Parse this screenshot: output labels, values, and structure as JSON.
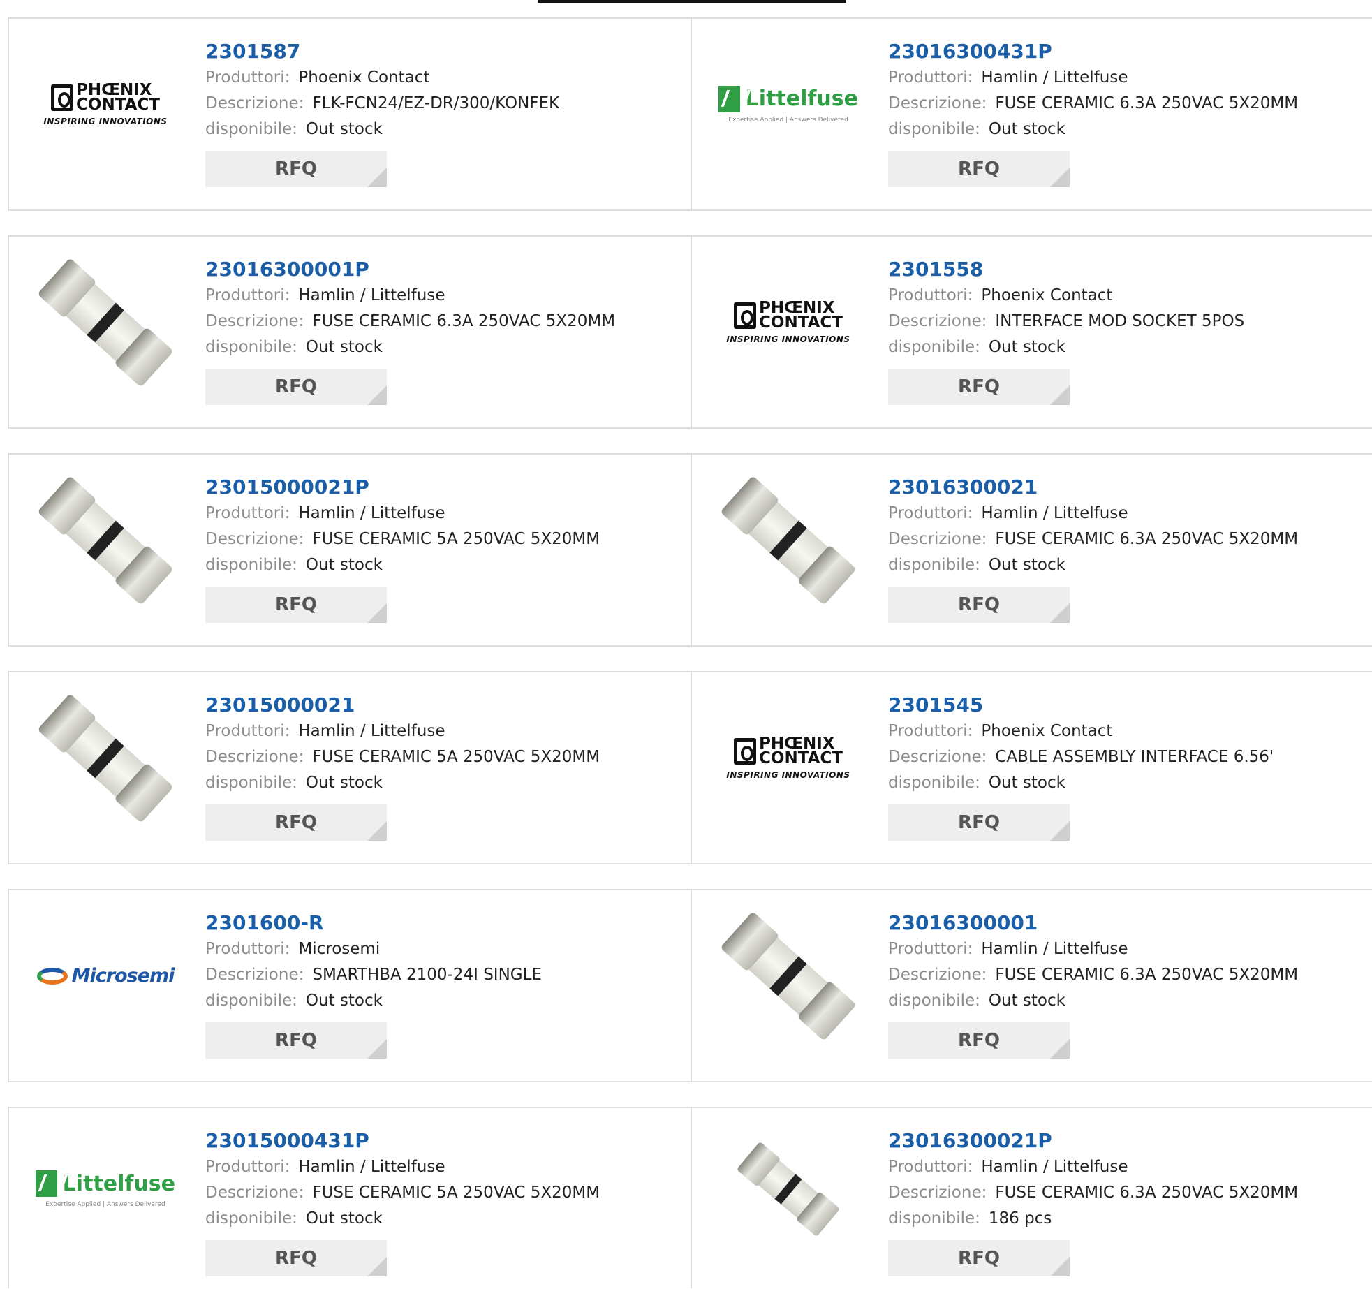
{
  "labels": {
    "manufacturer": "Produttori:",
    "description": "Descrizione:",
    "availability": "disponibile:",
    "rfq": "RFQ"
  },
  "products": [
    {
      "part": "2301587",
      "manufacturer": "Phoenix Contact",
      "description": "FLK-FCN24/EZ-DR/300/KONFEK",
      "availability": "Out stock",
      "image": "phoenix-contact-logo"
    },
    {
      "part": "23016300431P",
      "manufacturer": "Hamlin / Littelfuse",
      "description": "FUSE CERAMIC 6.3A 250VAC 5X20MM",
      "availability": "Out stock",
      "image": "littelfuse-logo"
    },
    {
      "part": "23016300001P",
      "manufacturer": "Hamlin / Littelfuse",
      "description": "FUSE CERAMIC 6.3A 250VAC 5X20MM",
      "availability": "Out stock",
      "image": "fuse-photo"
    },
    {
      "part": "2301558",
      "manufacturer": "Phoenix Contact",
      "description": "INTERFACE MOD SOCKET 5POS",
      "availability": "Out stock",
      "image": "phoenix-contact-logo"
    },
    {
      "part": "23015000021P",
      "manufacturer": "Hamlin / Littelfuse",
      "description": "FUSE CERAMIC 5A 250VAC 5X20MM",
      "availability": "Out stock",
      "image": "fuse-photo"
    },
    {
      "part": "23016300021",
      "manufacturer": "Hamlin / Littelfuse",
      "description": "FUSE CERAMIC 6.3A 250VAC 5X20MM",
      "availability": "Out stock",
      "image": "fuse-photo"
    },
    {
      "part": "23015000021",
      "manufacturer": "Hamlin / Littelfuse",
      "description": "FUSE CERAMIC 5A 250VAC 5X20MM",
      "availability": "Out stock",
      "image": "fuse-photo"
    },
    {
      "part": "2301545",
      "manufacturer": "Phoenix Contact",
      "description": "CABLE ASSEMBLY INTERFACE 6.56'",
      "availability": "Out stock",
      "image": "phoenix-contact-logo"
    },
    {
      "part": "2301600-R",
      "manufacturer": "Microsemi",
      "description": "SMARTHBA 2100-24I SINGLE",
      "availability": "Out stock",
      "image": "microsemi-logo"
    },
    {
      "part": "23016300001",
      "manufacturer": "Hamlin / Littelfuse",
      "description": "FUSE CERAMIC 6.3A 250VAC 5X20MM",
      "availability": "Out stock",
      "image": "fuse-photo"
    },
    {
      "part": "23015000431P",
      "manufacturer": "Hamlin / Littelfuse",
      "description": "FUSE CERAMIC 5A 250VAC 5X20MM",
      "availability": "Out stock",
      "image": "littelfuse-logo"
    },
    {
      "part": "23016300021P",
      "manufacturer": "Hamlin / Littelfuse",
      "description": "FUSE CERAMIC 6.3A 250VAC 5X20MM",
      "availability": "186 pcs",
      "image": "fuse-photo-small"
    }
  ],
  "logos": {
    "phoenix_words": [
      "PHŒNIX",
      "CONTACT"
    ],
    "phoenix_tag": "INSPIRING INNOVATIONS",
    "littelfuse_name": "Littelfuse",
    "littelfuse_tag": "Expertise Applied | Answers Delivered",
    "microsemi_name": "Microsemi"
  },
  "colors": {
    "part_link": "#1a5ea8",
    "label": "#8c8c8c",
    "button_bg": "#eeeeee",
    "border": "#dcdcdc"
  }
}
